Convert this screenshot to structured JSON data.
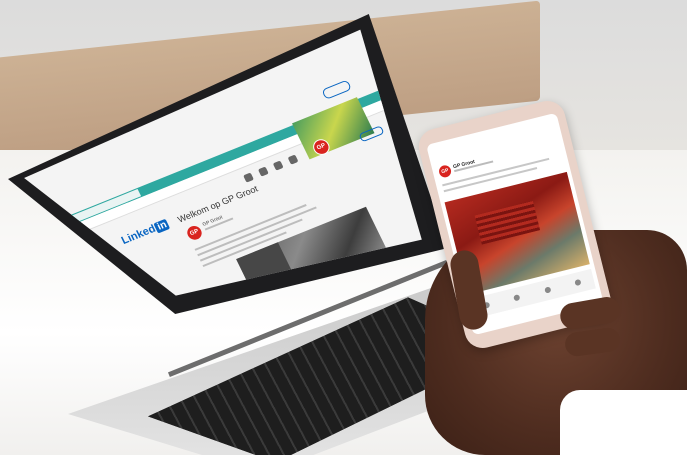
{
  "laptop": {
    "browser": {
      "tab_title": "",
      "url": ""
    },
    "linkedin": {
      "logo_text": "Linked",
      "logo_box": "in",
      "nav_labels": [
        "",
        "",
        "",
        ""
      ],
      "signin_label": "",
      "join_label": ""
    },
    "article": {
      "title": "Welkom op GP Groot",
      "author_logo": "GP",
      "author_name": "GP Groot"
    },
    "profile": {
      "logo": "GP",
      "follow_label": ""
    },
    "photo_mark": "GP"
  },
  "phone": {
    "status_time": "",
    "status_icons": "",
    "header": "",
    "page_logo": "GP",
    "page_name": "GP Groot"
  },
  "colors": {
    "linkedin_blue": "#0a66c2",
    "brand_red": "#d9241f",
    "browser_teal": "#2ea8a0"
  }
}
